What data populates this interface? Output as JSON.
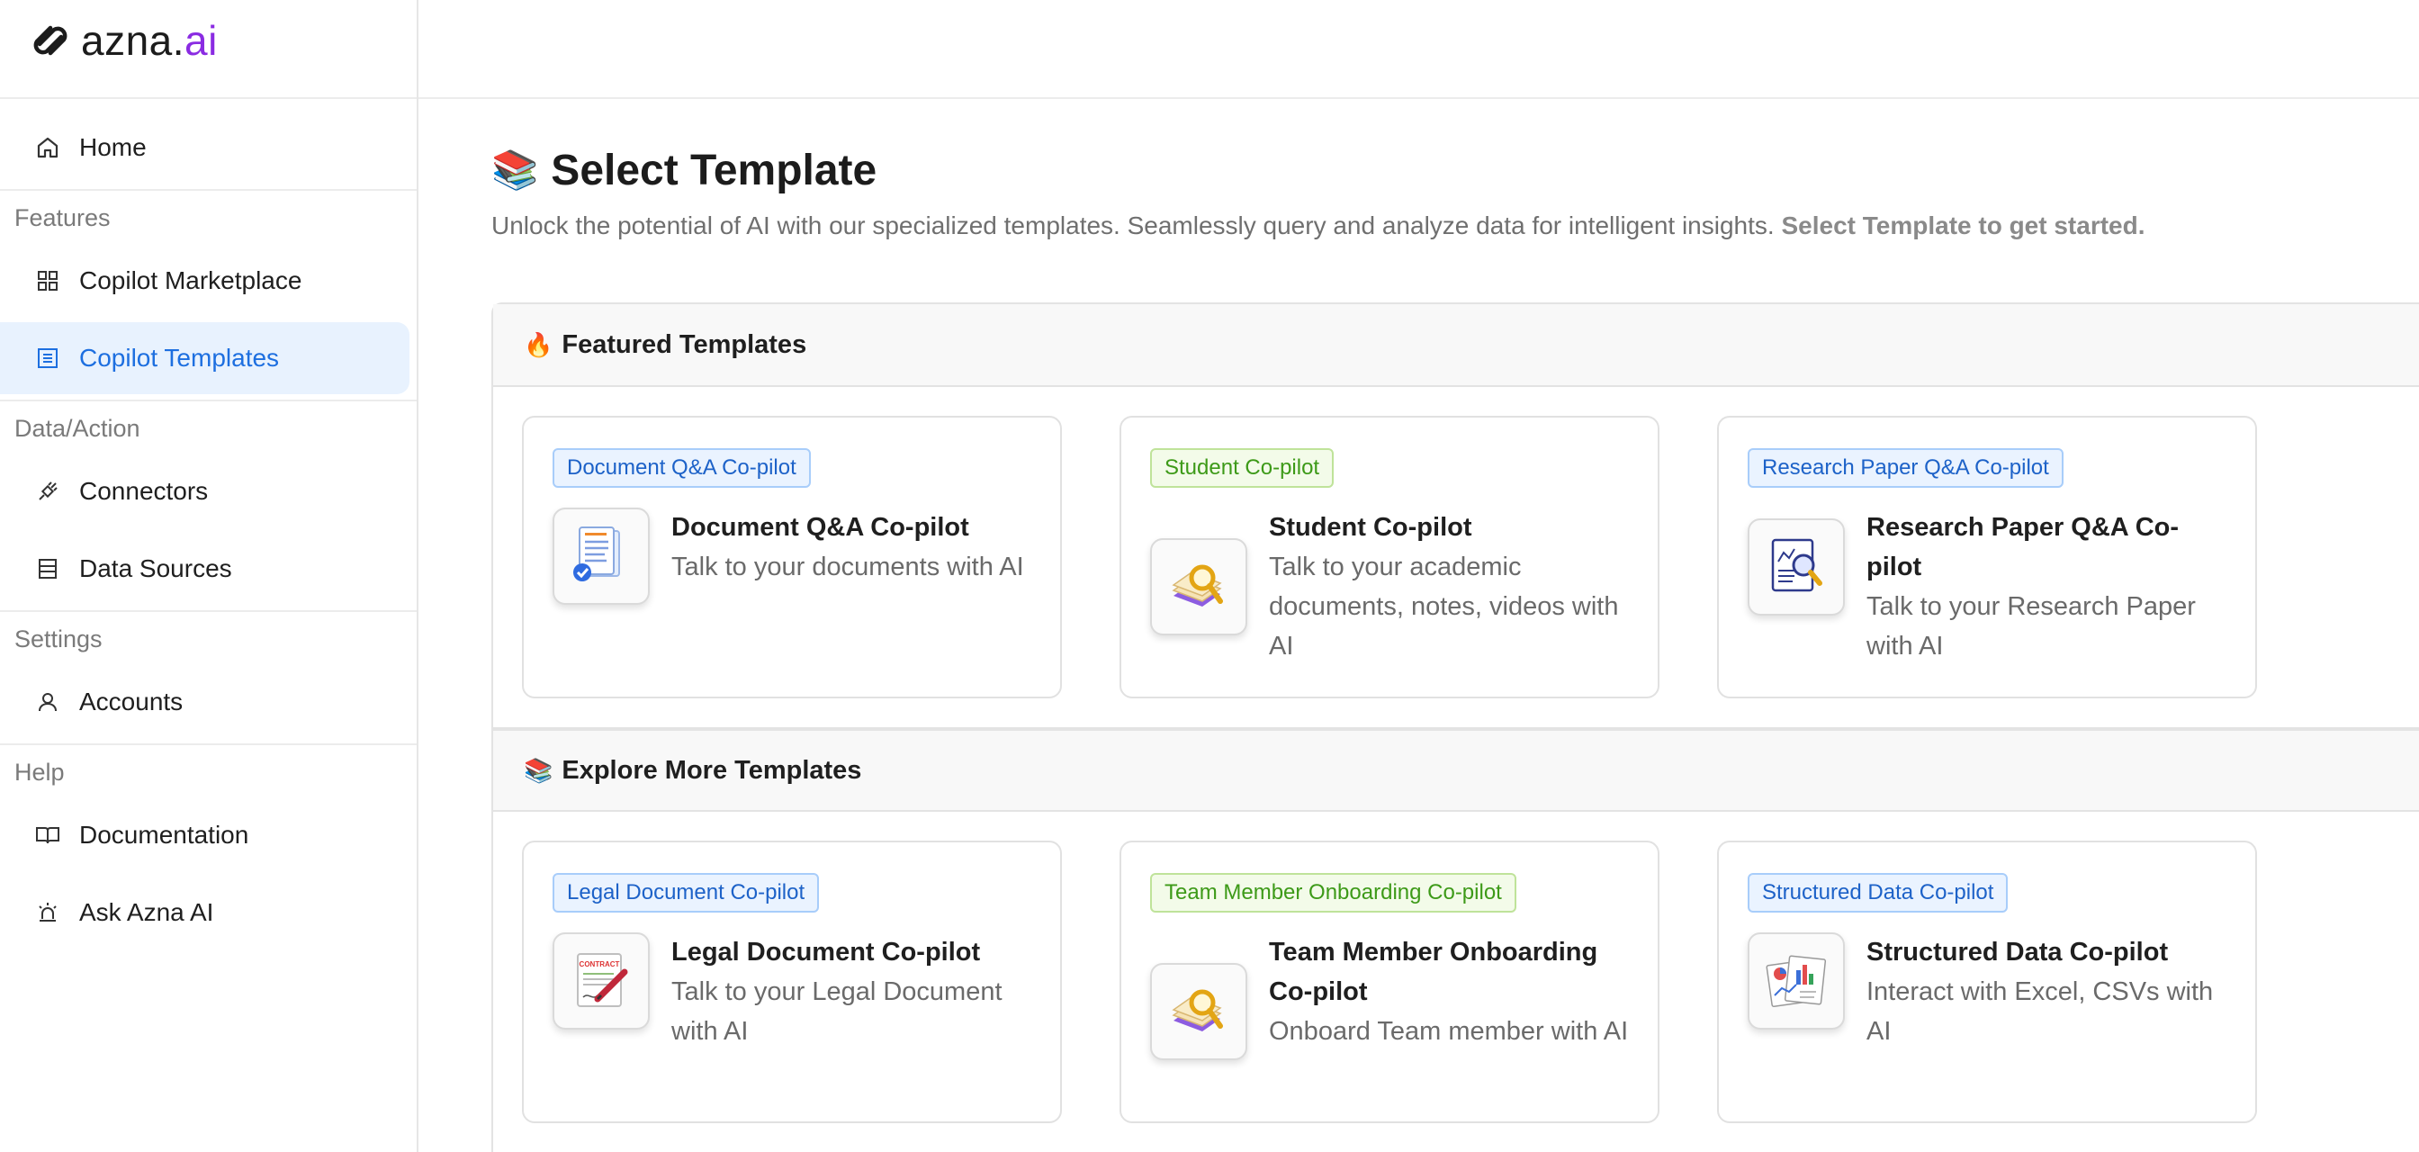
{
  "brand": {
    "name_prefix": "azna.",
    "name_suffix": "ai"
  },
  "sidebar": {
    "home": {
      "label": "Home"
    },
    "sections": [
      {
        "title": "Features",
        "items": [
          {
            "label": "Copilot Marketplace"
          },
          {
            "label": "Copilot Templates",
            "active": true
          }
        ]
      },
      {
        "title": "Data/Action",
        "items": [
          {
            "label": "Connectors"
          },
          {
            "label": "Data Sources"
          }
        ]
      },
      {
        "title": "Settings",
        "items": [
          {
            "label": "Accounts"
          }
        ]
      },
      {
        "title": "Help",
        "items": [
          {
            "label": "Documentation"
          },
          {
            "label": "Ask Azna AI"
          }
        ]
      }
    ]
  },
  "page": {
    "title_emoji": "📚",
    "title": "Select Template",
    "subtitle": "Unlock the potential of AI with our specialized templates. Seamlessly query and analyze data for intelligent insights.",
    "subtitle_bold": "Select Template to get started."
  },
  "featured": {
    "header_emoji": "🔥",
    "header": "Featured Templates",
    "cards": [
      {
        "tag": "Document Q&A Co-pilot",
        "tag_color": "blue",
        "title": "Document Q&A Co-pilot",
        "desc": "Talk to your documents with AI",
        "icon": "document-check-icon"
      },
      {
        "tag": "Student Co-pilot",
        "tag_color": "green",
        "title": "Student Co-pilot",
        "desc": "Talk to your academic documents, notes, videos with AI",
        "icon": "magnifier-book-icon"
      },
      {
        "tag": "Research Paper Q&A Co-pilot",
        "tag_color": "blue",
        "title": "Research Paper Q&A Co-pilot",
        "desc": "Talk to your Research Paper with AI",
        "icon": "research-paper-icon"
      }
    ]
  },
  "explore": {
    "header_emoji": "📚",
    "header": "Explore More Templates",
    "cards": [
      {
        "tag": "Legal Document Co-pilot",
        "tag_color": "blue",
        "title": "Legal Document Co-pilot",
        "desc": "Talk to your Legal Document with AI",
        "icon": "contract-icon",
        "contract_text": "CONTRACT"
      },
      {
        "tag": "Team Member Onboarding Co-pilot",
        "tag_color": "green",
        "title": "Team Member Onboarding Co-pilot",
        "desc": "Onboard Team member with AI",
        "icon": "magnifier-book-icon"
      },
      {
        "tag": "Structured Data Co-pilot",
        "tag_color": "blue",
        "title": "Structured Data Co-pilot",
        "desc": "Interact with Excel, CSVs with AI",
        "icon": "charts-icon"
      }
    ]
  },
  "colors": {
    "accent": "#1d6fe0",
    "brand_ai": "#8a2be2",
    "active_bg": "#e8f2fe"
  }
}
